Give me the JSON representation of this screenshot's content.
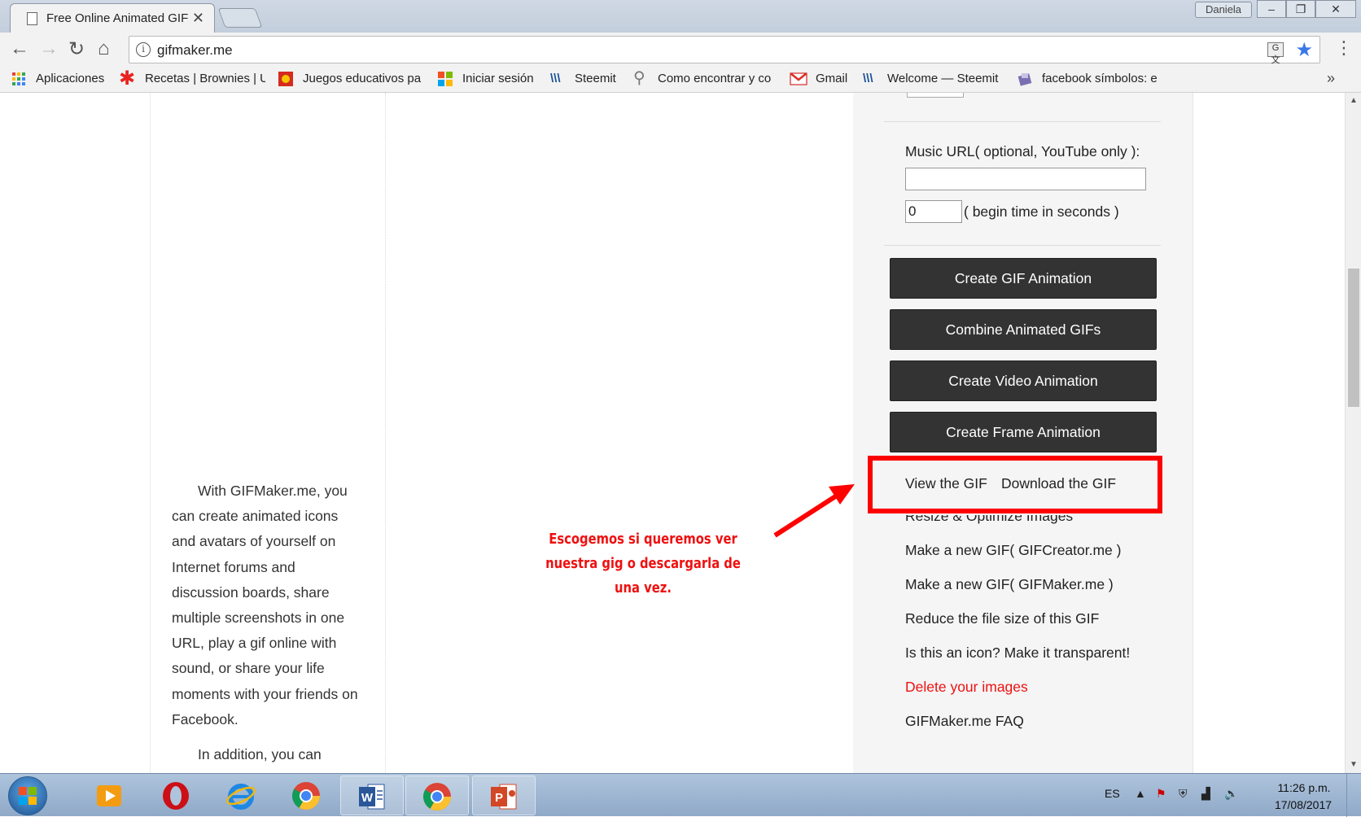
{
  "browser": {
    "tab_title": "Free Online Animated GIF",
    "tab_close": "✕",
    "profile_name": "Daniela",
    "window_buttons": [
      "–",
      "❐",
      "✕"
    ],
    "url": "gifmaker.me",
    "bookmarks": [
      {
        "label": "Aplicaciones",
        "icon": "apps-grid-icon"
      },
      {
        "label": "Recetas | Brownies | U",
        "icon": "asterisk-icon"
      },
      {
        "label": "Juegos educativos pa",
        "icon": "game-icon"
      },
      {
        "label": "Iniciar sesión",
        "icon": "windows-icon"
      },
      {
        "label": "Steemit",
        "icon": "steemit-icon"
      },
      {
        "label": "Como encontrar y co",
        "icon": "search-icon"
      },
      {
        "label": "Gmail",
        "icon": "gmail-icon"
      },
      {
        "label": "Welcome — Steemit",
        "icon": "steemit-icon"
      },
      {
        "label": "facebook símbolos: e",
        "icon": "facebook-symbol-icon"
      }
    ],
    "bookmarks_more": "»"
  },
  "page": {
    "intro_paragraph_1": "With GIFMaker.me, you can create animated icons and avatars of yourself on Internet forums and discussion boards, share multiple screenshots in one URL, play a gif online with sound, or share your life moments with your friends on Facebook.",
    "intro_paragraph_2": "In addition, you can",
    "music_label": "Music URL( optional, YouTube only ):",
    "music_url_value": "",
    "begin_time_value": "0",
    "begin_label": "( begin time in seconds )",
    "buttons": {
      "create_gif": "Create GIF Animation",
      "combine_gifs": "Combine Animated GIFs",
      "create_video": "Create Video Animation",
      "create_frame": "Create Frame Animation"
    },
    "links": {
      "view_gif": "View the GIF",
      "download_gif": "Download the GIF",
      "resize": "Resize & Optimize Images",
      "gifcreator": "Make a new GIF( GIFCreator.me )",
      "gifmaker": "Make a new GIF( GIFMaker.me )",
      "reduce": "Reduce the file size of this GIF",
      "transparent": "Is this an icon? Make it transparent!",
      "delete": "Delete your images",
      "faq": "GIFMaker.me FAQ"
    }
  },
  "annotation": {
    "text": "Escogemos si queremos ver nuestra gig o descargarla de una vez.",
    "color": "#ee1111"
  },
  "taskbar": {
    "pinned": [
      {
        "name": "media-player-icon",
        "open": false
      },
      {
        "name": "opera-icon",
        "open": false
      },
      {
        "name": "internet-explorer-icon",
        "open": false
      },
      {
        "name": "chrome-icon",
        "open": false
      },
      {
        "name": "word-icon",
        "open": true
      },
      {
        "name": "chrome-icon",
        "open": true
      },
      {
        "name": "powerpoint-icon",
        "open": true
      }
    ],
    "language": "ES",
    "time": "11:26 p.m.",
    "date": "17/08/2017"
  }
}
